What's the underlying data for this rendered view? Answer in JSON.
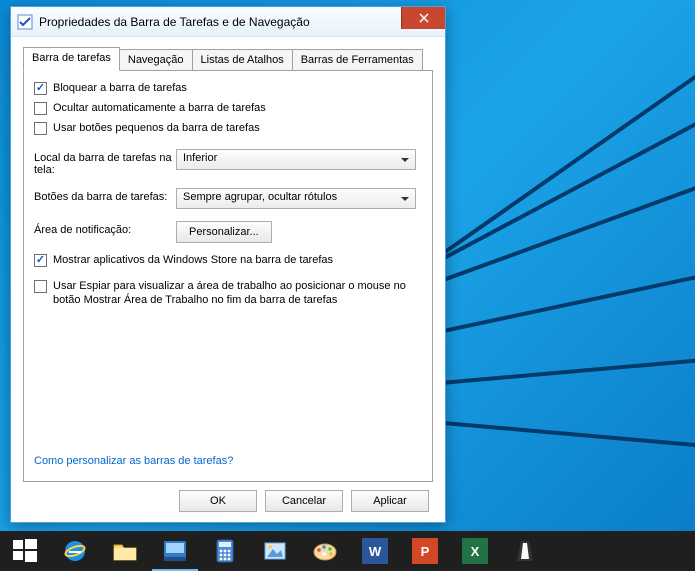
{
  "window": {
    "title": "Propriedades da Barra de Tarefas e de Navegação"
  },
  "tabs": {
    "items": [
      {
        "label": "Barra de tarefas",
        "active": true
      },
      {
        "label": "Navegação",
        "active": false
      },
      {
        "label": "Listas de Atalhos",
        "active": false
      },
      {
        "label": "Barras de Ferramentas",
        "active": false
      }
    ]
  },
  "options": {
    "lock_taskbar": {
      "label": "Bloquear a barra de tarefas",
      "checked": true
    },
    "auto_hide": {
      "label": "Ocultar automaticamente a barra de tarefas",
      "checked": false
    },
    "small_buttons": {
      "label": "Usar botões pequenos da barra de tarefas",
      "checked": false
    },
    "show_store_apps": {
      "label": "Mostrar aplicativos da Windows Store na barra de tarefas",
      "checked": true
    },
    "use_peek": {
      "label": "Usar Espiar para visualizar a área de trabalho ao posicionar o mouse no botão Mostrar Área de Trabalho no fim da barra de tarefas",
      "checked": false
    }
  },
  "fields": {
    "location": {
      "label": "Local da barra de tarefas na tela:",
      "value": "Inferior"
    },
    "buttons": {
      "label": "Botões da barra de tarefas:",
      "value": "Sempre agrupar, ocultar rótulos"
    },
    "notification": {
      "label": "Área de notificação:",
      "button": "Personalizar..."
    }
  },
  "link": {
    "label": "Como personalizar as barras de tarefas?"
  },
  "buttons": {
    "ok": "OK",
    "cancel": "Cancelar",
    "apply": "Aplicar"
  },
  "taskbar": {
    "word_letter": "W",
    "ppt_letter": "P",
    "excel_letter": "X"
  }
}
